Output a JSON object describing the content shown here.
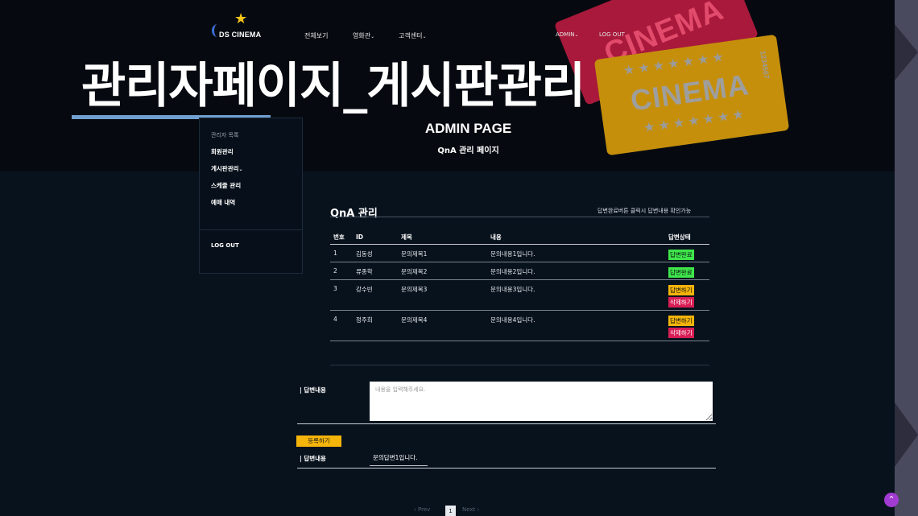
{
  "overlay_title": "관리자페이지_게시판관리",
  "logo": {
    "text": "DS CINEMA",
    "icon": "star-icon"
  },
  "nav": {
    "items": [
      {
        "label": "전체보기",
        "dropdown": false
      },
      {
        "label": "영화관",
        "dropdown": true
      },
      {
        "label": "고객센터",
        "dropdown": true
      }
    ],
    "admin": "ADMIN",
    "logout": "LOG OUT"
  },
  "tickets": {
    "word": "CINEMA",
    "serial": "1234567",
    "stars": "★★★★★★★"
  },
  "hero": {
    "title": "ADMIN PAGE",
    "subtitle": "QnA 관리 페이지"
  },
  "sidebar": {
    "heading": "관리자 목록",
    "items": [
      {
        "label": "회원관리"
      },
      {
        "label": "게시판관리"
      },
      {
        "label": "스케줄 관리"
      },
      {
        "label": "예매 내역"
      }
    ],
    "logout": "LOG OUT"
  },
  "qna": {
    "title": "QnA 관리",
    "note": "답변완료버튼 클릭시 답변내용 확인가능",
    "columns": [
      "번호",
      "ID",
      "제목",
      "내용",
      "답변상태"
    ],
    "rows": [
      {
        "no": "1",
        "id": "김동성",
        "title": "문의제목1",
        "content": "문의내용1입니다.",
        "status": "답변완료"
      },
      {
        "no": "2",
        "id": "류종학",
        "title": "문의제목2",
        "content": "문의내용2입니다.",
        "status": "답변완료"
      },
      {
        "no": "3",
        "id": "강수빈",
        "title": "문의제목3",
        "content": "문의내용3입니다.",
        "answer_btn": "답변하기",
        "delete_btn": "삭제하기"
      },
      {
        "no": "4",
        "id": "정주희",
        "title": "문의제목4",
        "content": "문의내용4입니다.",
        "answer_btn": "답변하기",
        "delete_btn": "삭제하기"
      }
    ]
  },
  "answer": {
    "label": "| 답변내용",
    "placeholder": "내용을 입력해주세요.",
    "register": "등록하기",
    "result_label": "| 답변내용",
    "result_value": "문의답변1입니다."
  },
  "pager": {
    "prev": "Prev",
    "current": "1",
    "next": "Next"
  },
  "colors": {
    "done": "#3ee64a",
    "answer": "#f5b40a",
    "delete": "#d81e55",
    "accent": "#6f9fcf"
  }
}
